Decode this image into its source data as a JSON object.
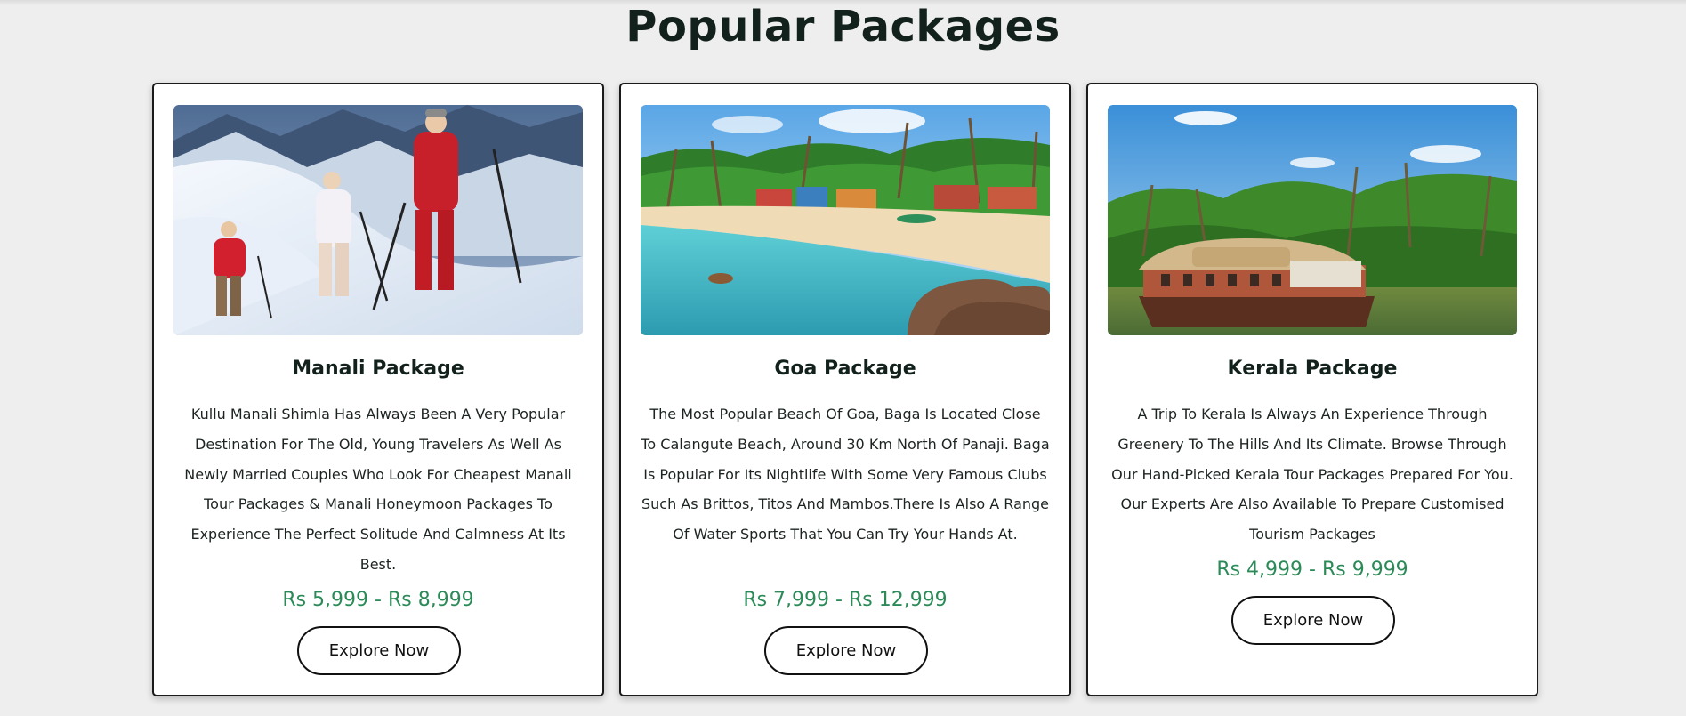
{
  "section": {
    "title": "Popular Packages"
  },
  "colors": {
    "price": "#2b8a57",
    "border": "#1a1a1a",
    "background": "#eeeeee"
  },
  "packages": [
    {
      "title": "Manali Package",
      "image": "snow-mountain-trekkers-photo",
      "description": "Kullu Manali Shimla Has Always Been A Very Popular Destination For The Old, Young Travelers As Well As Newly Married Couples Who Look For Cheapest Manali Tour Packages & Manali Honeymoon Packages To Experience The Perfect Solitude And Calmness At Its Best.",
      "price": "Rs 5,999 - Rs 8,999",
      "button": "Explore Now"
    },
    {
      "title": "Goa Package",
      "image": "palm-beach-photo",
      "description": "The Most Popular Beach Of Goa, Baga Is Located Close To Calangute Beach, Around 30 Km North Of Panaji. Baga Is Popular For Its Nightlife With Some Very Famous Clubs Such As Brittos, Titos And Mambos.There Is Also A Range Of Water Sports That You Can Try Your Hands At.",
      "price": "Rs 7,999 - Rs 12,999",
      "button": "Explore Now"
    },
    {
      "title": "Kerala Package",
      "image": "backwater-houseboat-photo",
      "description": "A Trip To Kerala Is Always An Experience Through Greenery To The Hills And Its Climate. Browse Through Our Hand-Picked Kerala Tour Packages Prepared For You. Our Experts Are Also Available To Prepare Customised Tourism Packages",
      "price": "Rs 4,999 - Rs 9,999",
      "button": "Explore Now"
    }
  ]
}
